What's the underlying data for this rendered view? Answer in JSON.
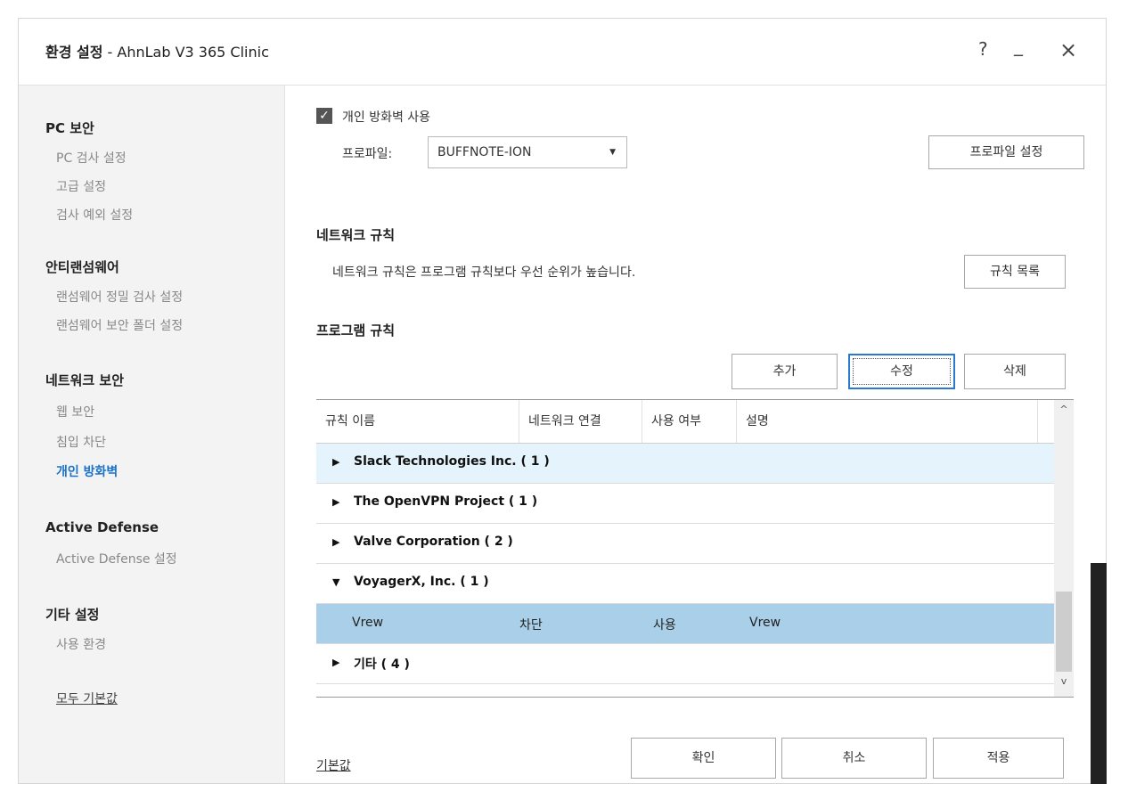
{
  "window": {
    "title_bold": "환경 설정",
    "title_rest": " - AhnLab V3 365 Clinic",
    "help": "?",
    "minimize": "_",
    "close": "×"
  },
  "sidebar": {
    "pc": {
      "title": "PC 보안",
      "items": [
        "PC 검사 설정",
        "고급 설정",
        "검사 예외 설정"
      ]
    },
    "ransom": {
      "title": "안티랜섬웨어",
      "items": [
        "랜섬웨어 정밀 검사 설정",
        "랜섬웨어 보안 폴더 설정"
      ]
    },
    "network": {
      "title": "네트워크 보안",
      "items": [
        "웹 보안",
        "침입 차단",
        "개인 방화벽"
      ]
    },
    "active": {
      "title": "Active Defense",
      "items": [
        "Active Defense 설정"
      ]
    },
    "etc": {
      "title": "기타 설정",
      "items": [
        "사용 환경"
      ]
    },
    "reset_all": "모두 기본값"
  },
  "firewall": {
    "enable_checked": "✓",
    "enable_label": "개인 방화벽 사용",
    "profile_label": "프로파일:",
    "profile_value": "BUFFNOTE-ION",
    "profile_settings": "프로파일 설정"
  },
  "network_rules": {
    "title": "네트워크 규칙",
    "desc": "네트워크 규칙은 프로그램 규칙보다 우선 순위가 높습니다.",
    "list_button": "규칙 목록"
  },
  "program_rules": {
    "title": "프로그램 규칙",
    "add": "추가",
    "edit": "수정",
    "delete": "삭제",
    "columns": [
      "규칙 이름",
      "네트워크 연결",
      "사용 여부",
      "설명"
    ],
    "groups": [
      {
        "arrow": "▶",
        "name": "Slack Technologies Inc. ( 1 )"
      },
      {
        "arrow": "▶",
        "name": "The OpenVPN Project ( 1 )"
      },
      {
        "arrow": "▶",
        "name": "Valve Corporation ( 2 )"
      },
      {
        "arrow": "▼",
        "name": "VoyagerX, Inc. ( 1 )"
      },
      {
        "arrow": "▶",
        "name": "기타 ( 4 )"
      }
    ],
    "selected_row": {
      "name": "Vrew",
      "connection": "차단",
      "enabled": "사용",
      "desc": "Vrew"
    },
    "scroll_up": "^",
    "scroll_down": "v"
  },
  "footer": {
    "default": "기본값",
    "ok": "확인",
    "cancel": "취소",
    "apply": "적용"
  },
  "colors": {
    "accent": "#1a73c9",
    "selected_row": "#a9d0e8",
    "hover_row": "#e5f3fc"
  }
}
